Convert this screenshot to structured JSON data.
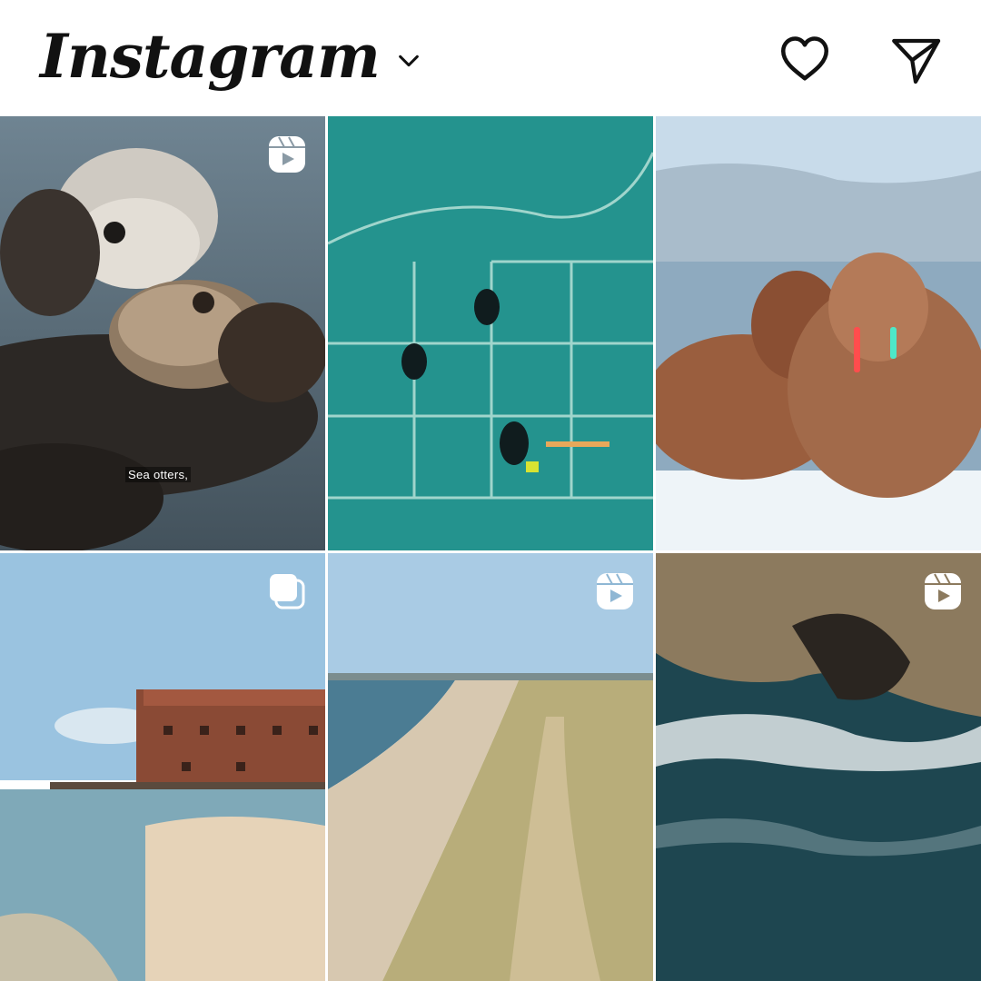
{
  "app": {
    "title": "Instagram"
  },
  "header": {
    "icons": [
      "chevron-down-icon",
      "heart-icon",
      "direct-message-icon"
    ]
  },
  "grid": {
    "tiles": [
      {
        "subject": "sea-otters",
        "badge": "reels-icon",
        "caption": "Sea otters,"
      },
      {
        "subject": "divers-underwater-grid",
        "badge": null
      },
      {
        "subject": "walruses-on-ice",
        "badge": null
      },
      {
        "subject": "brick-fort-by-sea",
        "badge": "carousel-icon"
      },
      {
        "subject": "beach-and-dunes-aerial",
        "badge": "reels-icon"
      },
      {
        "subject": "rocky-coast-waves",
        "badge": "reels-icon"
      }
    ]
  },
  "colors": {
    "background": "#ffffff",
    "icon": "#111111",
    "tile_gap": "#ffffff"
  }
}
